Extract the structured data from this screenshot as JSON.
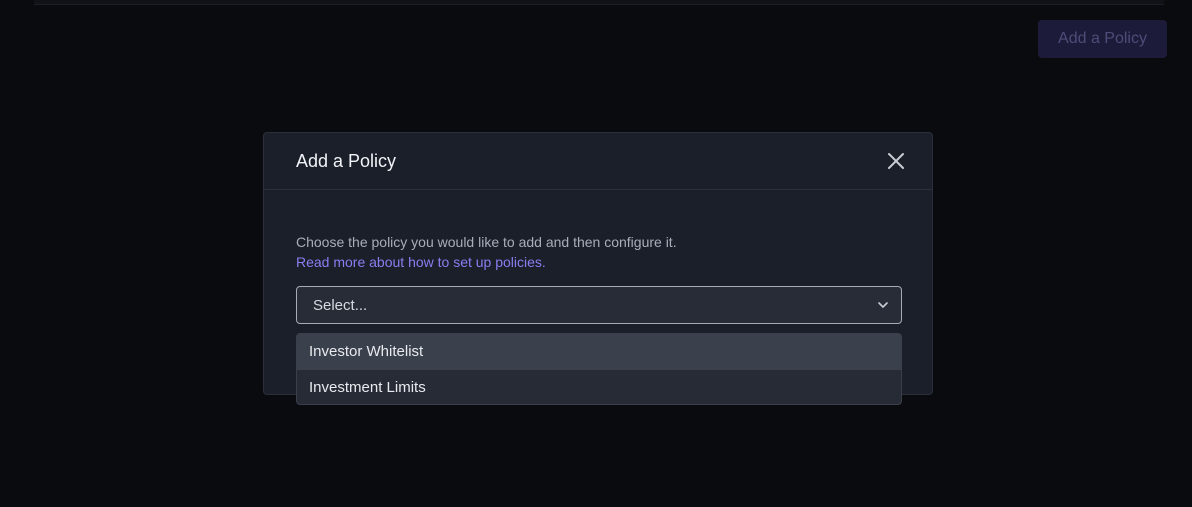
{
  "page": {
    "add_policy_button_label": "Add a Policy"
  },
  "modal": {
    "title": "Add a Policy",
    "description": "Choose the policy you would like to add and then configure it.",
    "help_link": "Read more about how to set up policies.",
    "select": {
      "placeholder": "Select..."
    },
    "options": [
      {
        "label": "Investor Whitelist",
        "highlighted": true
      },
      {
        "label": "Investment Limits",
        "highlighted": false
      }
    ]
  },
  "icons": {
    "close": "close-icon",
    "chevron": "chevron-down-icon"
  },
  "colors": {
    "background": "#0a0b0f",
    "modal_bg": "#1b1f2a",
    "accent_link": "#8a7df0",
    "button_bg": "#1d1b3a"
  }
}
